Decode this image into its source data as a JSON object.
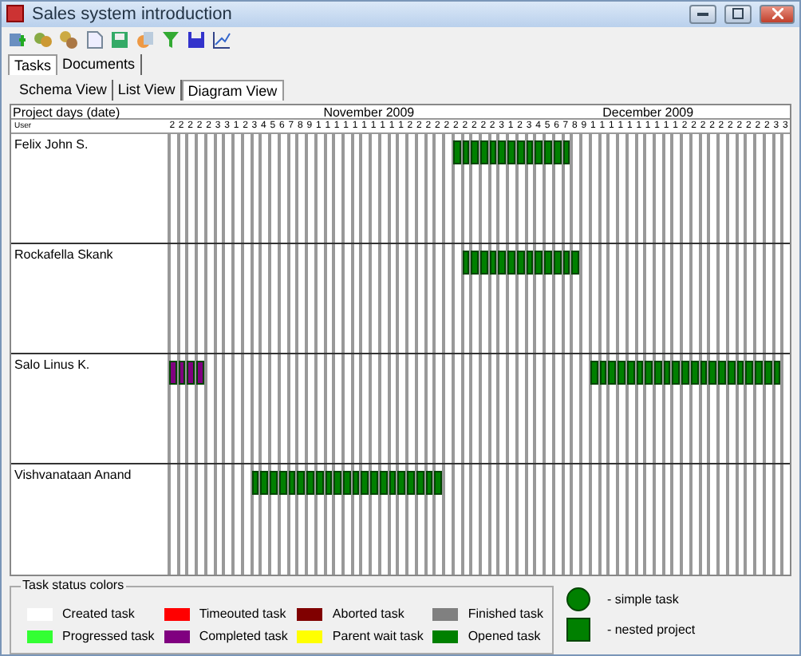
{
  "window": {
    "title": "Sales system introduction"
  },
  "toolbar": {
    "buttons": [
      {
        "kind": "add"
      },
      {
        "kind": "group"
      },
      {
        "kind": "group-alt"
      },
      {
        "kind": "doc"
      },
      {
        "kind": "disk"
      },
      {
        "kind": "export"
      },
      {
        "kind": "filter"
      },
      {
        "kind": "save"
      },
      {
        "kind": "chart"
      }
    ]
  },
  "tabs": [
    {
      "label": "Tasks",
      "selected": true
    },
    {
      "label": "Documents",
      "selected": false
    }
  ],
  "view_tabs": [
    {
      "label": "Schema View",
      "selected": false
    },
    {
      "label": "List View",
      "selected": false
    },
    {
      "label": "Diagram View",
      "selected": true
    }
  ],
  "diagram": {
    "corner_label": "Project days (date)",
    "user_label": "User",
    "months": [
      {
        "label": "November 2009"
      },
      {
        "label": "December 2009"
      }
    ],
    "days": [
      "2",
      "2",
      "2",
      "2",
      "2",
      "3",
      "3",
      "1",
      "2",
      "3",
      "4",
      "5",
      "6",
      "7",
      "8",
      "9",
      "1",
      "1",
      "1",
      "1",
      "1",
      "1",
      "1",
      "1",
      "1",
      "1",
      "2",
      "2",
      "2",
      "2",
      "2",
      "2",
      "2",
      "2",
      "2",
      "2",
      "3",
      "1",
      "2",
      "3",
      "4",
      "5",
      "6",
      "7",
      "8",
      "9",
      "1",
      "1",
      "1",
      "1",
      "1",
      "1",
      "1",
      "1",
      "1",
      "1",
      "2",
      "2",
      "2",
      "2",
      "2",
      "2",
      "2",
      "2",
      "2",
      "2",
      "3",
      "3"
    ],
    "users": [
      {
        "name": "Felix John S.",
        "cells": [
          null,
          null,
          null,
          null,
          null,
          null,
          null,
          null,
          null,
          null,
          null,
          null,
          null,
          null,
          null,
          null,
          null,
          null,
          null,
          null,
          null,
          null,
          null,
          null,
          null,
          null,
          null,
          null,
          null,
          null,
          null,
          {
            "color": "#008000"
          },
          {
            "color": "#008000"
          },
          {
            "color": "#008000"
          },
          {
            "color": "#008000"
          },
          {
            "color": "#008000"
          },
          {
            "color": "#008000"
          },
          {
            "color": "#008000"
          },
          {
            "color": "#008000"
          },
          {
            "color": "#008000"
          },
          {
            "color": "#008000"
          },
          {
            "color": "#008000"
          },
          {
            "color": "#008000"
          },
          {
            "color": "#008000"
          },
          null,
          null,
          null,
          null,
          null,
          null,
          null,
          null,
          null,
          null,
          null,
          null,
          null,
          null,
          null,
          null,
          null,
          null,
          null,
          null,
          null,
          null,
          null,
          null
        ]
      },
      {
        "name": "Rockafella Skank",
        "cells": [
          null,
          null,
          null,
          null,
          null,
          null,
          null,
          null,
          null,
          null,
          null,
          null,
          null,
          null,
          null,
          null,
          null,
          null,
          null,
          null,
          null,
          null,
          null,
          null,
          null,
          null,
          null,
          null,
          null,
          null,
          null,
          null,
          {
            "color": "#008000"
          },
          {
            "color": "#008000"
          },
          {
            "color": "#008000"
          },
          {
            "color": "#008000"
          },
          {
            "color": "#008000"
          },
          {
            "color": "#008000"
          },
          {
            "color": "#008000"
          },
          {
            "color": "#008000"
          },
          {
            "color": "#008000"
          },
          {
            "color": "#008000"
          },
          {
            "color": "#008000"
          },
          {
            "color": "#008000"
          },
          {
            "color": "#008000"
          },
          null,
          null,
          null,
          null,
          null,
          null,
          null,
          null,
          null,
          null,
          null,
          null,
          null,
          null,
          null,
          null,
          null,
          null,
          null,
          null,
          null,
          null,
          null
        ]
      },
      {
        "name": "Salo Linus K.",
        "cells": [
          {
            "color": "#800080"
          },
          {
            "color": "#800080"
          },
          {
            "color": "#800080"
          },
          {
            "color": "#800080"
          },
          null,
          null,
          null,
          null,
          null,
          null,
          null,
          null,
          null,
          null,
          null,
          null,
          null,
          null,
          null,
          null,
          null,
          null,
          null,
          null,
          null,
          null,
          null,
          null,
          null,
          null,
          null,
          null,
          null,
          null,
          null,
          null,
          null,
          null,
          null,
          null,
          null,
          null,
          null,
          null,
          null,
          null,
          {
            "color": "#008000"
          },
          {
            "color": "#008000"
          },
          {
            "color": "#008000"
          },
          {
            "color": "#008000"
          },
          {
            "color": "#008000"
          },
          {
            "color": "#008000"
          },
          {
            "color": "#008000"
          },
          {
            "color": "#008000"
          },
          {
            "color": "#008000"
          },
          {
            "color": "#008000"
          },
          {
            "color": "#008000"
          },
          {
            "color": "#008000"
          },
          {
            "color": "#008000"
          },
          {
            "color": "#008000"
          },
          {
            "color": "#008000"
          },
          {
            "color": "#008000"
          },
          {
            "color": "#008000"
          },
          {
            "color": "#008000"
          },
          {
            "color": "#008000"
          },
          {
            "color": "#008000"
          },
          {
            "color": "#008000"
          },
          null
        ]
      },
      {
        "name": "Vishvanataan Anand",
        "cells": [
          null,
          null,
          null,
          null,
          null,
          null,
          null,
          null,
          null,
          {
            "color": "#008000"
          },
          {
            "color": "#008000"
          },
          {
            "color": "#008000"
          },
          {
            "color": "#008000"
          },
          {
            "color": "#008000"
          },
          {
            "color": "#008000"
          },
          {
            "color": "#008000"
          },
          {
            "color": "#008000"
          },
          {
            "color": "#008000"
          },
          {
            "color": "#008000"
          },
          {
            "color": "#008000"
          },
          {
            "color": "#008000"
          },
          {
            "color": "#008000"
          },
          {
            "color": "#008000"
          },
          {
            "color": "#008000"
          },
          {
            "color": "#008000"
          },
          {
            "color": "#008000"
          },
          {
            "color": "#008000"
          },
          {
            "color": "#008000"
          },
          {
            "color": "#008000"
          },
          {
            "color": "#008000"
          },
          null,
          null,
          null,
          null,
          null,
          null,
          null,
          null,
          null,
          null,
          null,
          null,
          null,
          null,
          null,
          null,
          null,
          null,
          null,
          null,
          null,
          null,
          null,
          null,
          null,
          null,
          null,
          null,
          null,
          null,
          null,
          null,
          null,
          null,
          null,
          null,
          null,
          null
        ]
      }
    ]
  },
  "legend": {
    "title": "Task status colors",
    "statuses": [
      {
        "label": "Created task",
        "color": "#ffffff"
      },
      {
        "label": "Progressed task",
        "color": "#33ff33"
      },
      {
        "label": "Timeouted task",
        "color": "#ff0000"
      },
      {
        "label": "Completed task",
        "color": "#800080"
      },
      {
        "label": "Aborted task",
        "color": "#800000"
      },
      {
        "label": "Parent wait task",
        "color": "#ffff00"
      },
      {
        "label": "Finished task",
        "color": "#808080"
      },
      {
        "label": "Opened task",
        "color": "#008000"
      }
    ],
    "symbols": [
      {
        "kind": "circle",
        "label": "- simple task"
      },
      {
        "kind": "square",
        "label": "- nested project"
      }
    ]
  }
}
